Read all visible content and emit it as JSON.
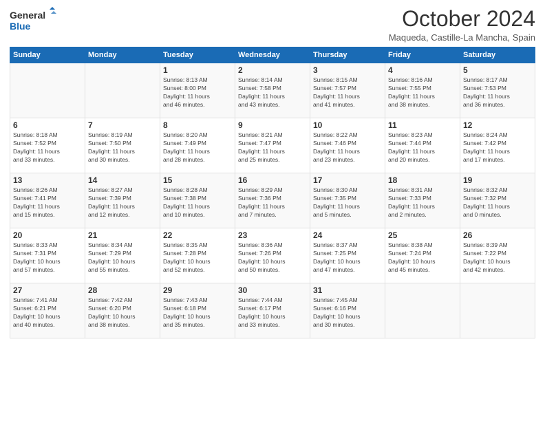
{
  "header": {
    "logo_line1": "General",
    "logo_line2": "Blue",
    "month": "October 2024",
    "location": "Maqueda, Castille-La Mancha, Spain"
  },
  "weekdays": [
    "Sunday",
    "Monday",
    "Tuesday",
    "Wednesday",
    "Thursday",
    "Friday",
    "Saturday"
  ],
  "weeks": [
    [
      {
        "day": "",
        "info": ""
      },
      {
        "day": "",
        "info": ""
      },
      {
        "day": "1",
        "info": "Sunrise: 8:13 AM\nSunset: 8:00 PM\nDaylight: 11 hours\nand 46 minutes."
      },
      {
        "day": "2",
        "info": "Sunrise: 8:14 AM\nSunset: 7:58 PM\nDaylight: 11 hours\nand 43 minutes."
      },
      {
        "day": "3",
        "info": "Sunrise: 8:15 AM\nSunset: 7:57 PM\nDaylight: 11 hours\nand 41 minutes."
      },
      {
        "day": "4",
        "info": "Sunrise: 8:16 AM\nSunset: 7:55 PM\nDaylight: 11 hours\nand 38 minutes."
      },
      {
        "day": "5",
        "info": "Sunrise: 8:17 AM\nSunset: 7:53 PM\nDaylight: 11 hours\nand 36 minutes."
      }
    ],
    [
      {
        "day": "6",
        "info": "Sunrise: 8:18 AM\nSunset: 7:52 PM\nDaylight: 11 hours\nand 33 minutes."
      },
      {
        "day": "7",
        "info": "Sunrise: 8:19 AM\nSunset: 7:50 PM\nDaylight: 11 hours\nand 30 minutes."
      },
      {
        "day": "8",
        "info": "Sunrise: 8:20 AM\nSunset: 7:49 PM\nDaylight: 11 hours\nand 28 minutes."
      },
      {
        "day": "9",
        "info": "Sunrise: 8:21 AM\nSunset: 7:47 PM\nDaylight: 11 hours\nand 25 minutes."
      },
      {
        "day": "10",
        "info": "Sunrise: 8:22 AM\nSunset: 7:46 PM\nDaylight: 11 hours\nand 23 minutes."
      },
      {
        "day": "11",
        "info": "Sunrise: 8:23 AM\nSunset: 7:44 PM\nDaylight: 11 hours\nand 20 minutes."
      },
      {
        "day": "12",
        "info": "Sunrise: 8:24 AM\nSunset: 7:42 PM\nDaylight: 11 hours\nand 17 minutes."
      }
    ],
    [
      {
        "day": "13",
        "info": "Sunrise: 8:26 AM\nSunset: 7:41 PM\nDaylight: 11 hours\nand 15 minutes."
      },
      {
        "day": "14",
        "info": "Sunrise: 8:27 AM\nSunset: 7:39 PM\nDaylight: 11 hours\nand 12 minutes."
      },
      {
        "day": "15",
        "info": "Sunrise: 8:28 AM\nSunset: 7:38 PM\nDaylight: 11 hours\nand 10 minutes."
      },
      {
        "day": "16",
        "info": "Sunrise: 8:29 AM\nSunset: 7:36 PM\nDaylight: 11 hours\nand 7 minutes."
      },
      {
        "day": "17",
        "info": "Sunrise: 8:30 AM\nSunset: 7:35 PM\nDaylight: 11 hours\nand 5 minutes."
      },
      {
        "day": "18",
        "info": "Sunrise: 8:31 AM\nSunset: 7:33 PM\nDaylight: 11 hours\nand 2 minutes."
      },
      {
        "day": "19",
        "info": "Sunrise: 8:32 AM\nSunset: 7:32 PM\nDaylight: 11 hours\nand 0 minutes."
      }
    ],
    [
      {
        "day": "20",
        "info": "Sunrise: 8:33 AM\nSunset: 7:31 PM\nDaylight: 10 hours\nand 57 minutes."
      },
      {
        "day": "21",
        "info": "Sunrise: 8:34 AM\nSunset: 7:29 PM\nDaylight: 10 hours\nand 55 minutes."
      },
      {
        "day": "22",
        "info": "Sunrise: 8:35 AM\nSunset: 7:28 PM\nDaylight: 10 hours\nand 52 minutes."
      },
      {
        "day": "23",
        "info": "Sunrise: 8:36 AM\nSunset: 7:26 PM\nDaylight: 10 hours\nand 50 minutes."
      },
      {
        "day": "24",
        "info": "Sunrise: 8:37 AM\nSunset: 7:25 PM\nDaylight: 10 hours\nand 47 minutes."
      },
      {
        "day": "25",
        "info": "Sunrise: 8:38 AM\nSunset: 7:24 PM\nDaylight: 10 hours\nand 45 minutes."
      },
      {
        "day": "26",
        "info": "Sunrise: 8:39 AM\nSunset: 7:22 PM\nDaylight: 10 hours\nand 42 minutes."
      }
    ],
    [
      {
        "day": "27",
        "info": "Sunrise: 7:41 AM\nSunset: 6:21 PM\nDaylight: 10 hours\nand 40 minutes."
      },
      {
        "day": "28",
        "info": "Sunrise: 7:42 AM\nSunset: 6:20 PM\nDaylight: 10 hours\nand 38 minutes."
      },
      {
        "day": "29",
        "info": "Sunrise: 7:43 AM\nSunset: 6:18 PM\nDaylight: 10 hours\nand 35 minutes."
      },
      {
        "day": "30",
        "info": "Sunrise: 7:44 AM\nSunset: 6:17 PM\nDaylight: 10 hours\nand 33 minutes."
      },
      {
        "day": "31",
        "info": "Sunrise: 7:45 AM\nSunset: 6:16 PM\nDaylight: 10 hours\nand 30 minutes."
      },
      {
        "day": "",
        "info": ""
      },
      {
        "day": "",
        "info": ""
      }
    ]
  ]
}
